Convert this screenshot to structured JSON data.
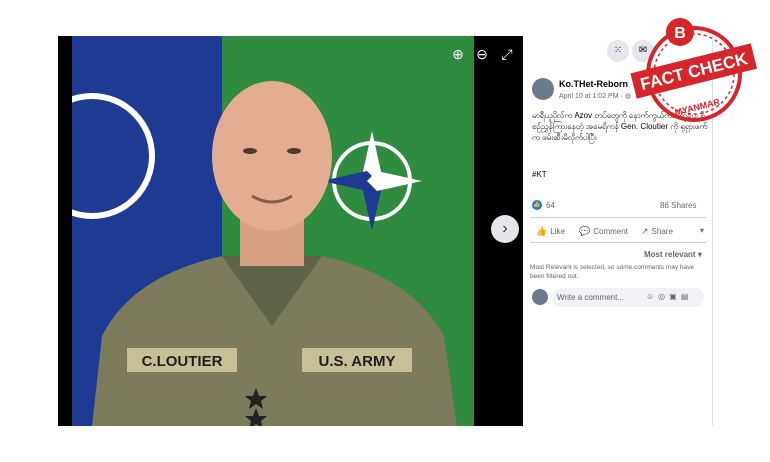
{
  "viewer": {
    "zoom_in_icon": "zoom-in-icon",
    "zoom_out_icon": "zoom-out-icon",
    "fullscreen_icon": "fullscreen-icon",
    "next_icon": "chevron-right-icon",
    "photo_name_tape": "C.LOUTIER",
    "photo_branch_tape": "U.S. ARMY"
  },
  "post": {
    "author": "Ko.THet-Reborn",
    "time": "April 10 at 1:02 PM · ",
    "text": "မာရီယူပိုလ်က Azov တပ်တွေကို နောက်ကွယ်ကအကူပေး စီစဥ်ညွှန်ကြားနေတဲ့ အမေရိကန် Gen. Cloutier ကို ရုရှားဖက်က ဖမ်းဆီးမိလိုက်ပါပြီး",
    "hashtag": "#KT",
    "likes": "64",
    "shares": "86 Shares"
  },
  "actions": {
    "like": "Like",
    "comment": "Comment",
    "share": "Share"
  },
  "comments": {
    "sort": "Most relevant",
    "note": "Most Relevant is selected, so some comments may have been filtered out.",
    "placeholder": "Write a comment..."
  },
  "badge": {
    "letter": "B",
    "title": "FACT CHECK",
    "subtitle": "MYANMAR",
    "color": "#d7262b"
  },
  "colors": {
    "like_blue": "#1877f2",
    "flag_blue": "#1f3a93",
    "flag_green": "#2f8b3f"
  }
}
